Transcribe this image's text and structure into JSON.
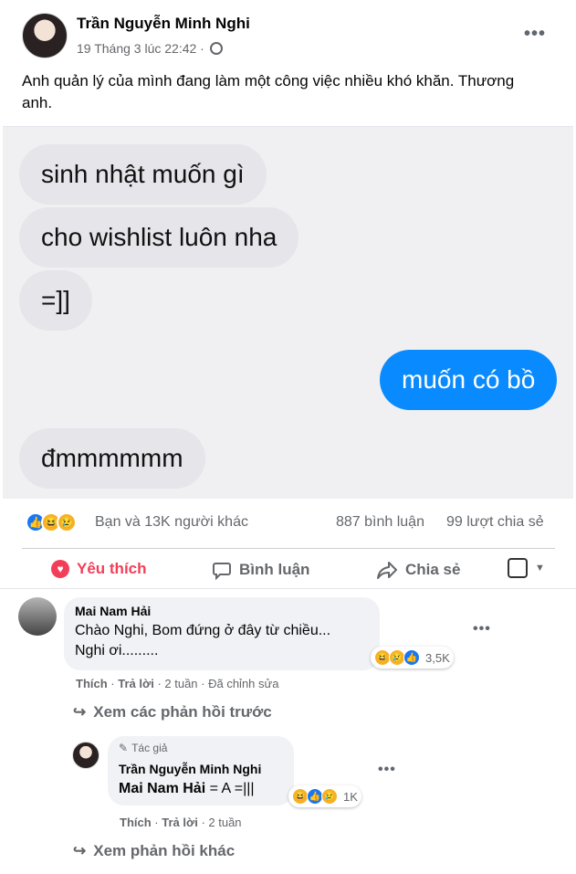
{
  "post": {
    "author": "Trần Nguyễn Minh Nghi",
    "time": "19 Tháng 3 lúc 22:42 ·",
    "caption": "Anh quản lý của mình đang làm một công việc nhiều khó khăn. Thương anh."
  },
  "chat": {
    "messages": [
      {
        "text": "sinh nhật muốn gì",
        "side": "left"
      },
      {
        "text": "cho wishlist luôn nha",
        "side": "left"
      },
      {
        "text": "=]]",
        "side": "left"
      },
      {
        "text": "muốn có bồ",
        "side": "right"
      },
      {
        "text": "đmmmmmm",
        "side": "left"
      }
    ]
  },
  "stats": {
    "reactions_text": "Bạn và 13K người khác",
    "comments": "887 bình luận",
    "shares": "99 lượt chia sẻ"
  },
  "actions": {
    "like": "Yêu thích",
    "comment": "Bình luận",
    "share": "Chia sẻ"
  },
  "comments": [
    {
      "name": "Mai Nam Hải",
      "line1": "Chào Nghi, Bom đứng ở đây từ chiều...",
      "line2": "Nghi ơi.........",
      "reaction_count": "3,5K",
      "like": "Thích",
      "reply": "Trả lời",
      "meta": "· 2 tuần · Đã chỉnh sửa"
    }
  ],
  "view_previous": "Xem các phản hồi trước",
  "reply": {
    "badge": "Tác giả",
    "name": "Trần Nguyễn Minh Nghi",
    "mention": "Mai Nam Hải",
    "text": " = A =|||",
    "reaction_count": "1K",
    "like": "Thích",
    "reply": "Trả lời",
    "meta": "· 2 tuần"
  },
  "view_more": "Xem phản hồi khác",
  "colors": {
    "accent_blue": "#0a8aff",
    "liked_red": "#f33e58",
    "bubble_gray": "#e5e5ea"
  },
  "icons": [
    "globe-icon",
    "more-icon",
    "heart-icon",
    "comment-icon",
    "share-icon",
    "reply-arrow-icon",
    "pencil-icon"
  ]
}
